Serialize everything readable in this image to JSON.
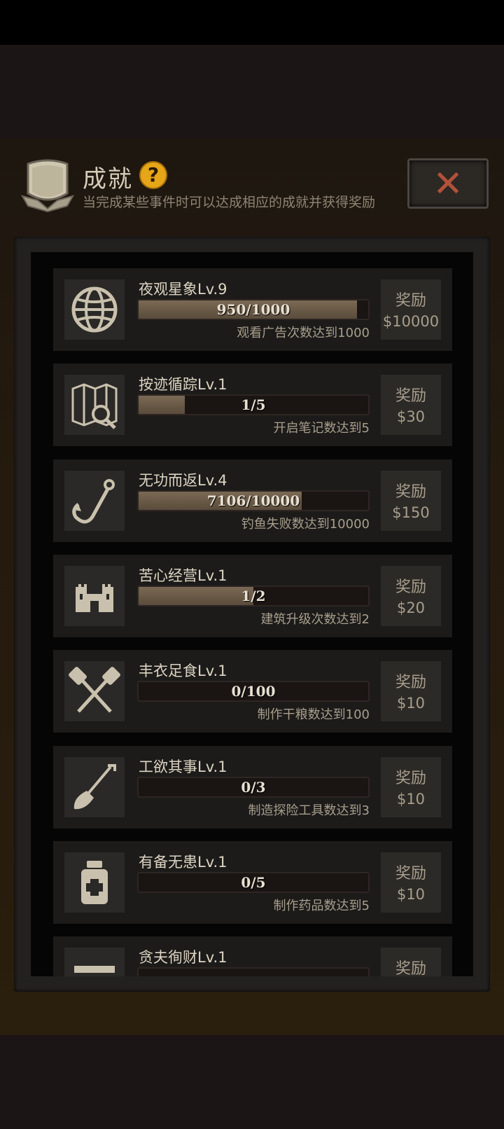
{
  "header": {
    "title": "成就",
    "help_icon": "?",
    "subtitle": "当完成某些事件时可以达成相应的成就并获得奖励",
    "close_icon": "✕"
  },
  "achievements": [
    {
      "name": "夜观星象Lv.9",
      "progress_text": "950/1000",
      "progress": 0.95,
      "desc": "观看广告次数达到1000",
      "reward_label": "奖励",
      "reward_value": "$10000",
      "icon": "globe-icon"
    },
    {
      "name": "按迹循踪Lv.1",
      "progress_text": "1/5",
      "progress": 0.2,
      "desc": "开启笔记数达到5",
      "reward_label": "奖励",
      "reward_value": "$30",
      "icon": "map-search-icon"
    },
    {
      "name": "无功而返Lv.4",
      "progress_text": "7106/10000",
      "progress": 0.7106,
      "desc": "钓鱼失败数达到10000",
      "reward_label": "奖励",
      "reward_value": "$150",
      "icon": "fishing-hook-icon"
    },
    {
      "name": "苦心经营Lv.1",
      "progress_text": "1/2",
      "progress": 0.5,
      "desc": "建筑升级次数达到2",
      "reward_label": "奖励",
      "reward_value": "$20",
      "icon": "castle-icon"
    },
    {
      "name": "丰衣足食Lv.1",
      "progress_text": "0/100",
      "progress": 0,
      "desc": "制作干粮数达到100",
      "reward_label": "奖励",
      "reward_value": "$10",
      "icon": "crossed-spatulas-icon"
    },
    {
      "name": "工欲其事Lv.1",
      "progress_text": "0/3",
      "progress": 0,
      "desc": "制造探险工具数达到3",
      "reward_label": "奖励",
      "reward_value": "$10",
      "icon": "shovel-icon"
    },
    {
      "name": "有备无患Lv.1",
      "progress_text": "0/5",
      "progress": 0,
      "desc": "制作药品数达到5",
      "reward_label": "奖励",
      "reward_value": "$10",
      "icon": "medicine-bottle-icon"
    },
    {
      "name": "贪夫徇财Lv.1",
      "progress_text": "",
      "progress": 0,
      "desc": "",
      "reward_label": "奖励",
      "reward_value": "",
      "icon": "chest-icon"
    }
  ]
}
